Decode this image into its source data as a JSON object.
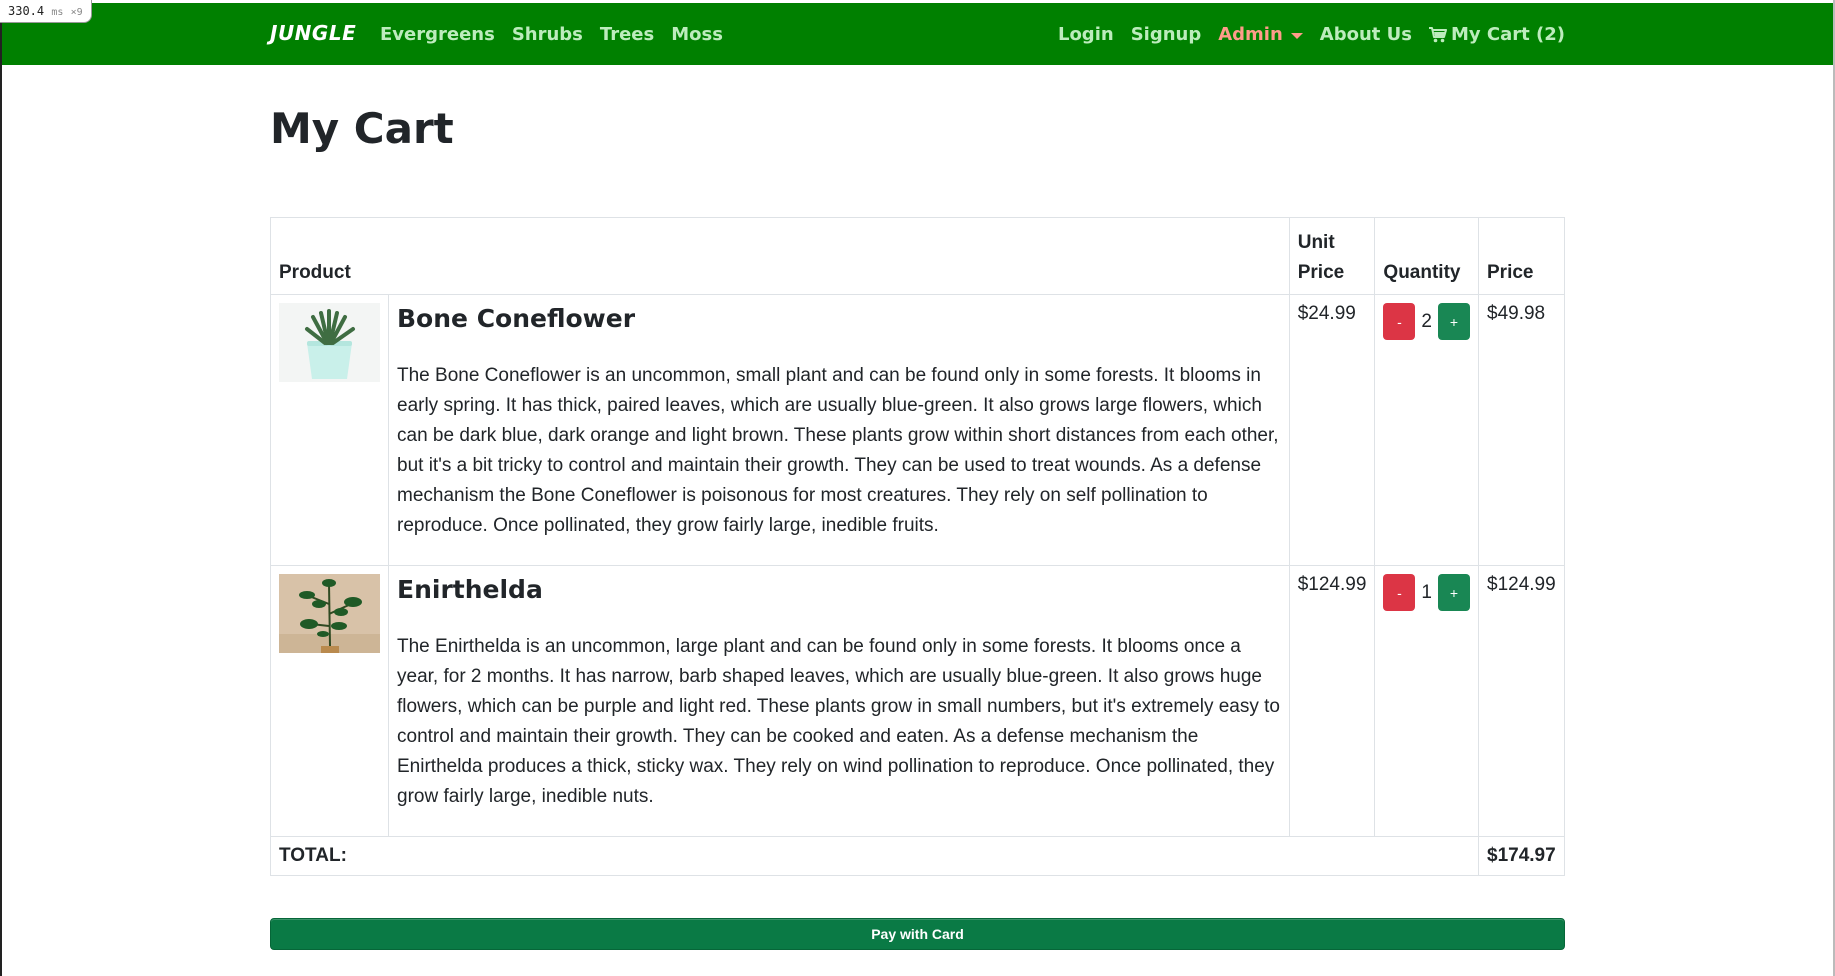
{
  "timing": {
    "value": "330.4",
    "unit": "ms",
    "count": "×9"
  },
  "colors": {
    "navbar": "#008000",
    "nav_link": "#bdecbd",
    "admin": "#ff9c8a",
    "minus": "#dc3545",
    "plus": "#198754",
    "pay": "#0a7a45"
  },
  "nav": {
    "brand": "JUNGLE",
    "categories": [
      "Evergreens",
      "Shrubs",
      "Trees",
      "Moss"
    ],
    "login": "Login",
    "signup": "Signup",
    "admin": "Admin",
    "about": "About Us",
    "cart": "My Cart (2)",
    "cart_icon": "shopping-cart-icon"
  },
  "page": {
    "title": "My Cart"
  },
  "table": {
    "headers": {
      "product": "Product",
      "unit_price": "Unit Price",
      "quantity": "Quantity",
      "price": "Price"
    },
    "items": [
      {
        "name": "Bone Coneflower",
        "description": "The Bone Coneflower is an uncommon, small plant and can be found only in some forests. It blooms in early spring. It has thick, paired leaves, which are usually blue-green. It also grows large flowers, which can be dark blue, dark orange and light brown. These plants grow within short distances from each other, but it's a bit tricky to control and maintain their growth. They can be used to treat wounds. As a defense mechanism the Bone Coneflower is poisonous for most creatures. They rely on self pollination to reproduce. Once pollinated, they grow fairly large, inedible fruits.",
        "unit_price": "$24.99",
        "quantity": "2",
        "price": "$49.98",
        "minus": "-",
        "plus": "+"
      },
      {
        "name": "Enirthelda",
        "description": "The Enirthelda is an uncommon, large plant and can be found only in some forests. It blooms once a year, for 2 months. It has narrow, barb shaped leaves, which are usually blue-green. It also grows huge flowers, which can be purple and light red. These plants grow in small numbers, but it's extremely easy to control and maintain their growth. They can be cooked and eaten. As a defense mechanism the Enirthelda produces a thick, sticky wax. They rely on wind pollination to reproduce. Once pollinated, they grow fairly large, inedible nuts.",
        "unit_price": "$124.99",
        "quantity": "1",
        "price": "$124.99",
        "minus": "-",
        "plus": "+"
      }
    ],
    "total_label": "TOTAL:",
    "total_value": "$174.97"
  },
  "pay_button": "Pay with Card"
}
